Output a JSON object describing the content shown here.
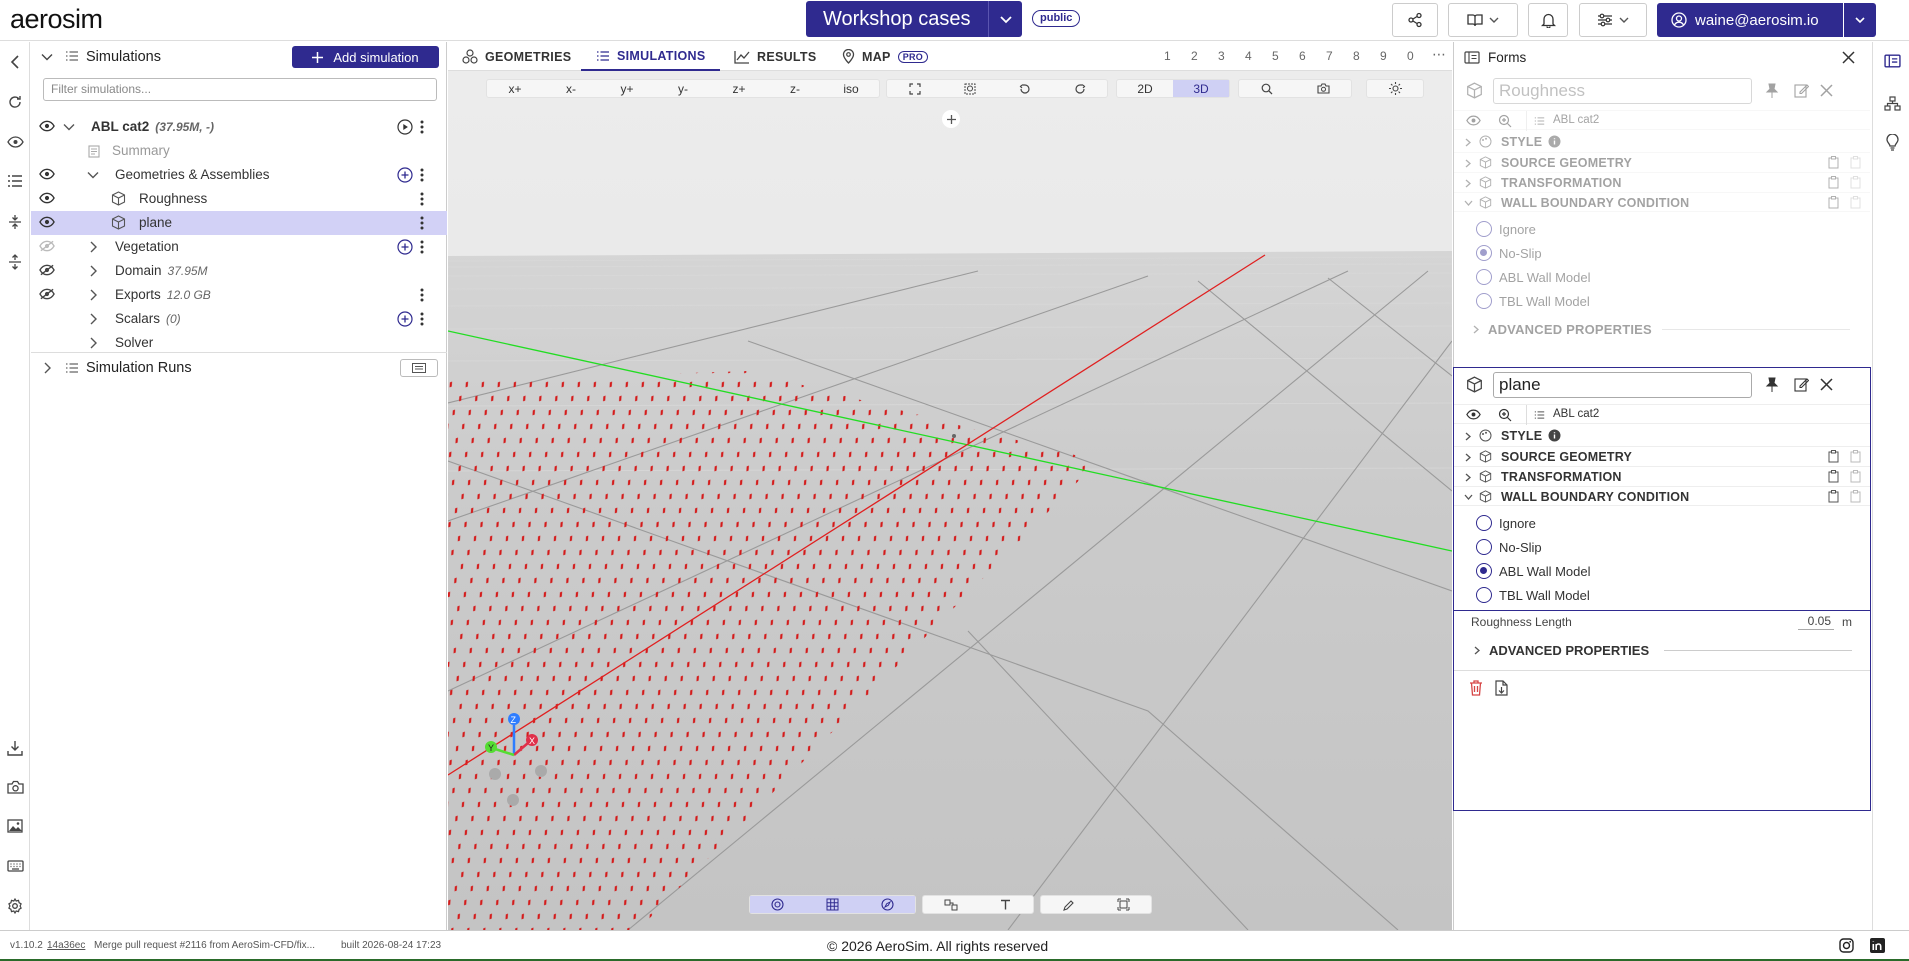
{
  "header": {
    "logo": "aerosim",
    "project_name": "Workshop cases",
    "visibility_badge": "public",
    "user_email": "waine@aerosim.io"
  },
  "simulations_panel": {
    "title": "Simulations",
    "add_button": "Add simulation",
    "filter_placeholder": "Filter simulations...",
    "tree": {
      "sim_name": "ABL cat2",
      "sim_meta": "(37.95M, -)",
      "summary": "Summary",
      "geometries": "Geometries & Assemblies",
      "roughness": "Roughness",
      "plane": "plane",
      "vegetation": "Vegetation",
      "domain": "Domain",
      "domain_meta": "37.95M",
      "exports": "Exports",
      "exports_meta": "12.0 GB",
      "scalars": "Scalars",
      "scalars_meta": "(0)",
      "solver": "Solver"
    },
    "runs_title": "Simulation Runs"
  },
  "viewport": {
    "tabs": [
      "GEOMETRIES",
      "SIMULATIONS",
      "RESULTS",
      "MAP"
    ],
    "active_tab": "SIMULATIONS",
    "pro_badge": "PRO",
    "numbers": [
      "1",
      "2",
      "3",
      "4",
      "5",
      "6",
      "7",
      "8",
      "9",
      "0",
      "⋯"
    ],
    "view_buttons": [
      "x+",
      "x-",
      "y+",
      "y-",
      "z+",
      "z-",
      "iso"
    ],
    "mode_buttons": [
      "2D",
      "3D"
    ],
    "active_mode": "3D",
    "axes": {
      "x": "X",
      "y": "Y",
      "z": "Z"
    }
  },
  "forms": {
    "title": "Forms",
    "card1": {
      "name": "Roughness",
      "sim": "ABL cat2",
      "sections": [
        "STYLE",
        "SOURCE GEOMETRY",
        "TRANSFORMATION",
        "WALL BOUNDARY CONDITION"
      ],
      "options": [
        "Ignore",
        "No-Slip",
        "ABL Wall Model",
        "TBL Wall Model"
      ],
      "selected": "No-Slip",
      "advanced": "ADVANCED PROPERTIES"
    },
    "card2": {
      "name": "plane",
      "sim": "ABL cat2",
      "sections": [
        "STYLE",
        "SOURCE GEOMETRY",
        "TRANSFORMATION",
        "WALL BOUNDARY CONDITION"
      ],
      "options": [
        "Ignore",
        "No-Slip",
        "ABL Wall Model",
        "TBL Wall Model"
      ],
      "selected": "ABL Wall Model",
      "roughness_label": "Roughness Length",
      "roughness_value": "0.05",
      "roughness_unit": "m",
      "advanced": "ADVANCED PROPERTIES"
    }
  },
  "footer": {
    "version": "v1.10.2",
    "commit": "14a36ec",
    "message": "Merge pull request #2116 from AeroSim-CFD/fix...",
    "built": "built 2026-08-24 17:23",
    "copyright": "© 2026 AeroSim. All rights reserved"
  },
  "colors": {
    "accent": "#2f2a8f",
    "selected_row": "#d2d1f6",
    "danger": "#d64545",
    "x_axis": "#e02020",
    "y_axis": "#22cc22"
  },
  "icons": [
    "share-icon",
    "book-icon",
    "bell-icon",
    "settings-sliders-icon",
    "user-icon",
    "eye-icon",
    "eye-off-icon",
    "play-icon",
    "cube-icon",
    "pin-icon",
    "edit-icon",
    "close-icon",
    "zoom-icon",
    "list-icon",
    "trash-icon",
    "export-icon",
    "instagram-icon",
    "linkedin-icon",
    "lightbulb-icon",
    "hierarchy-icon",
    "camera-icon",
    "image-icon",
    "keyboard-icon",
    "gear-icon",
    "download-icon"
  ]
}
